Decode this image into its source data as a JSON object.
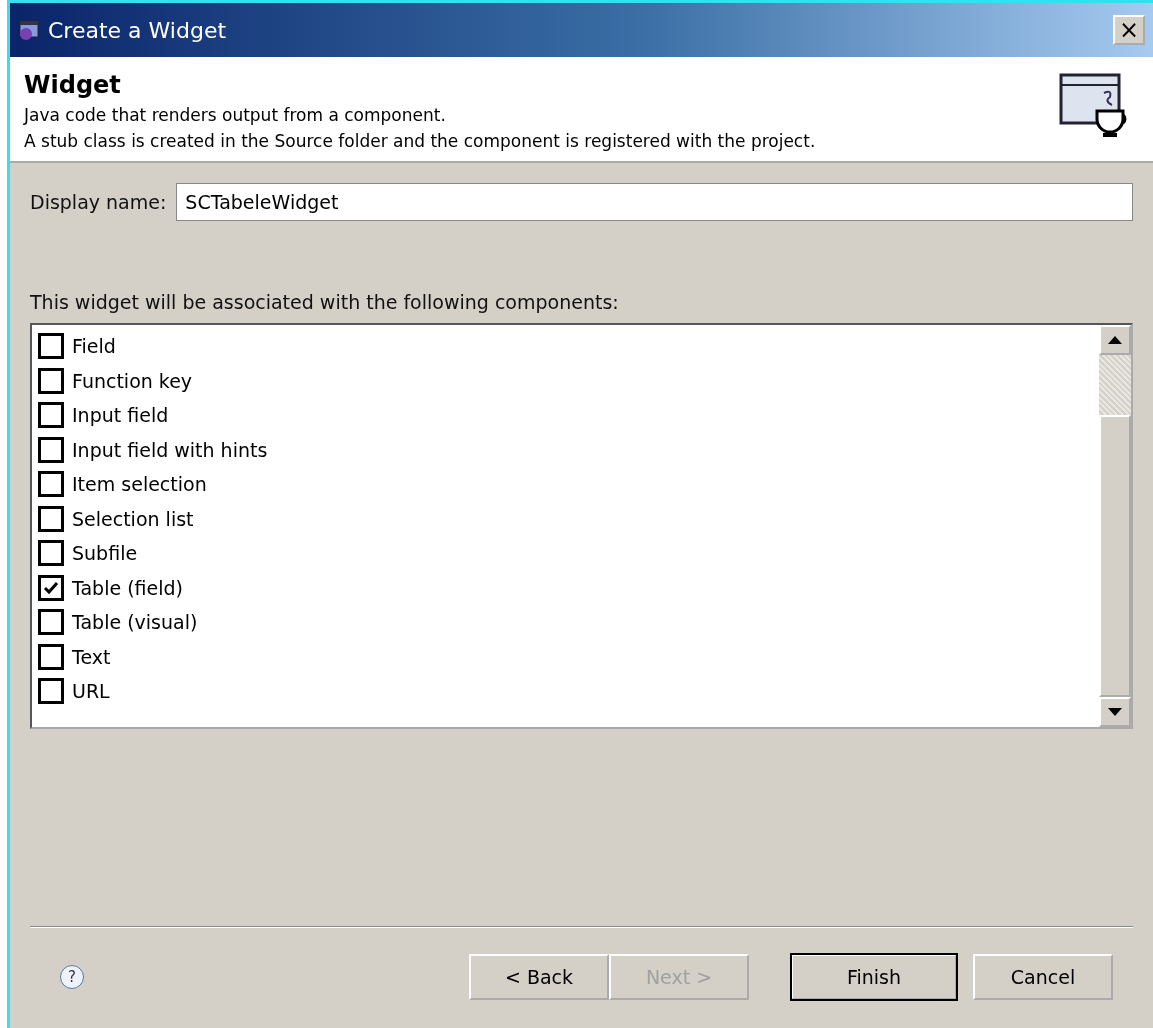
{
  "window": {
    "title": "Create a Widget",
    "close": "×"
  },
  "header": {
    "title": "Widget",
    "description": [
      "Java code that renders output from a component.",
      "A stub class is created in the Source folder and the component is registered with the project."
    ]
  },
  "display_name": {
    "label": "Display name:",
    "value": "SCTabeleWidget"
  },
  "components_label": "This widget will be associated with the following components:",
  "components": [
    {
      "label": "Field",
      "checked": false
    },
    {
      "label": "Function key",
      "checked": false
    },
    {
      "label": "Input field",
      "checked": false
    },
    {
      "label": "Input field with hints",
      "checked": false
    },
    {
      "label": "Item selection",
      "checked": false
    },
    {
      "label": "Selection list",
      "checked": false
    },
    {
      "label": "Subfile",
      "checked": false
    },
    {
      "label": "Table (field)",
      "checked": true
    },
    {
      "label": "Table (visual)",
      "checked": false
    },
    {
      "label": "Text",
      "checked": false
    },
    {
      "label": "URL",
      "checked": false
    }
  ],
  "help": "?",
  "buttons": [
    {
      "label": "< Back",
      "disabled": false,
      "default": false
    },
    {
      "label": "Next >",
      "disabled": true,
      "default": false
    },
    {
      "label": "Finish",
      "disabled": false,
      "default": true
    },
    {
      "label": "Cancel",
      "disabled": false,
      "default": false
    }
  ]
}
